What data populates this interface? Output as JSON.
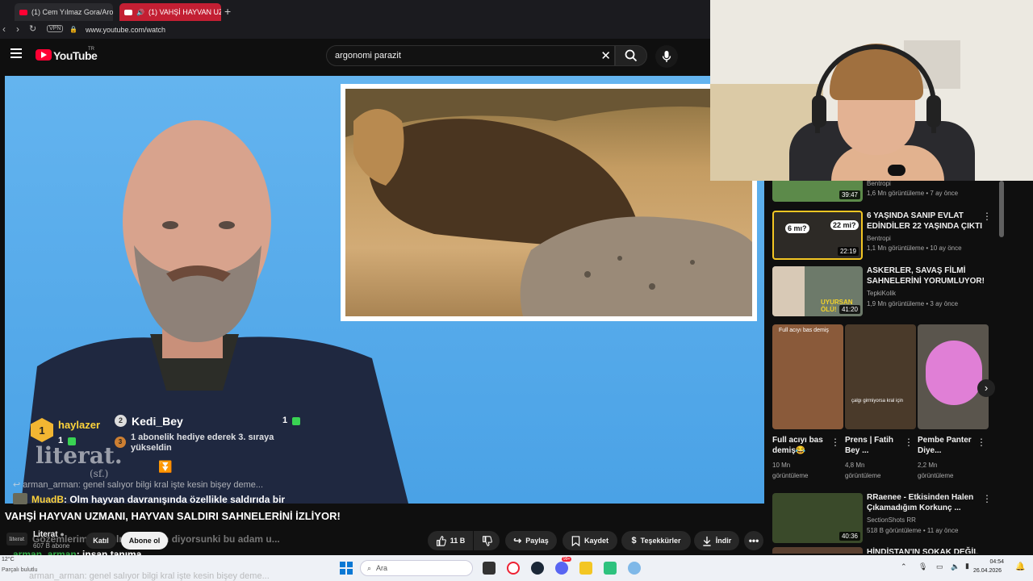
{
  "browser": {
    "tabs": [
      {
        "label": "(1) Cem Yılmaz Gora/Arog"
      },
      {
        "label": "(1) VAHŞİ HAYVAN UZ"
      }
    ],
    "vpn": "VPN",
    "url": "www.youtube.com/watch"
  },
  "youtube": {
    "logo": "YouTube",
    "region": "TR",
    "search_value": "argonomi parazit"
  },
  "chat": {
    "top_user_1": "haylazer",
    "top_user_1_rank": "1",
    "top_user_1_count": "1",
    "top_user_2": "Kedi_Bey",
    "top_user_2_rank": "2",
    "top_user_2_count": "1",
    "gift_rank": "3",
    "gift_text_1": "1 abonelik hediye ederek 3. sıraya",
    "gift_text_2": "yükseldin",
    "reply_line": "arman_arman: genel salıyor bilgi kral işte kesin bişey deme...",
    "msg1_user": "MuadB",
    "msg1_text": ": Olm hayvan davranışında özellikle saldırıda bir",
    "msg2_text": "Gözemlerimiz tutulmamış sen diyorsunki bu adam u...",
    "msg3_user": "arman_arman",
    "msg3_text": ": insan tanıma",
    "msg4_text": "arman_arman: genel salıyor bilgi kral işte kesin bişey deme..."
  },
  "video": {
    "title": "VAHŞİ HAYVAN UZMANI, HAYVAN SALDIRI SAHNELERİNİ İZLİYOR!",
    "watermark": "literat.",
    "watermark_sub": "(sf.)"
  },
  "channel": {
    "name": "Literat",
    "subs": "607 B abone",
    "join": "Katıl",
    "subscribe": "Abone ol"
  },
  "actions": {
    "likes": "11 B",
    "share": "Paylaş",
    "save": "Kaydet",
    "thanks": "Teşekkürler",
    "download": "İndir"
  },
  "sidebar": {
    "videos": [
      {
        "title": "",
        "channel": "Bentropi",
        "meta": "1,6 Mn görüntüleme • 7 ay önce",
        "duration": "39:47"
      },
      {
        "title": "6 YAŞINDA SANIP EVLAT EDİNDİLER 22 YAŞINDA ÇIKTI",
        "channel": "Bentropi",
        "meta": "1,1 Mn görüntüleme • 10 ay önce",
        "duration": "22:19",
        "thumb_text_1": "6 mı?",
        "thumb_text_2": "22 mi?"
      },
      {
        "title": "ASKERLER, SAVAŞ FİLMİ SAHNELERİNİ YORUMLUYOR!",
        "channel": "TepkiKolik",
        "meta": "1,9 Mn görüntüleme • 3 ay önce",
        "duration": "41:20",
        "thumb_text": "UYURSAN ÖLÜ!"
      },
      {
        "title": "RRaenee - Etkisinden Halen Çıkamadığım Korkunç ...",
        "channel": "SectionShots RR",
        "meta": "518 B görüntüleme • 11 ay önce",
        "duration": "40:36"
      },
      {
        "title": "HİNDİSTAN'IN SOKAK DEĞİL",
        "channel": "",
        "meta": "",
        "duration": ""
      }
    ],
    "shorts": [
      {
        "title": "Full acıyı bas demiş😂",
        "views": "10 Mn",
        "views_label": "görüntüleme",
        "caption": "Full acıyı bas demiş"
      },
      {
        "title": "Prens | Fatih Bey ...",
        "views": "4,8 Mn",
        "views_label": "görüntüleme",
        "caption": "çalgı girmiyorsa kral için"
      },
      {
        "title": "Pembe Panter Diye...",
        "views": "2,2 Mn",
        "views_label": "görüntüleme",
        "caption": ""
      }
    ]
  },
  "taskbar": {
    "weather": "12°C",
    "weather_desc": "Parçalı bulutlu",
    "search": "Ara",
    "badge": "99+",
    "time": "04:54",
    "date": "26.04.2026"
  },
  "colors": {
    "youtube_red": "#ff0033",
    "video_bg": "#56aaea",
    "chat_yellow": "#ffd43b",
    "chat_green": "#39d353"
  }
}
